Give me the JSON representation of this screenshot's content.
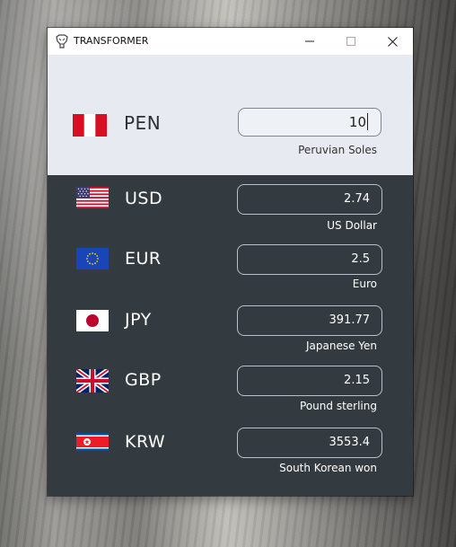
{
  "window": {
    "title": "TRANSFORMER"
  },
  "base": {
    "code": "PEN",
    "name": "Peruvian Soles",
    "amount": "10",
    "flag_icon": "peru-flag-icon"
  },
  "targets": [
    {
      "code": "USD",
      "name": "US Dollar",
      "value": "2.74",
      "flag_icon": "usa-flag-icon"
    },
    {
      "code": "EUR",
      "name": "Euro",
      "value": "2.5",
      "flag_icon": "eu-flag-icon"
    },
    {
      "code": "JPY",
      "name": "Japanese Yen",
      "value": "391.77",
      "flag_icon": "japan-flag-icon"
    },
    {
      "code": "GBP",
      "name": "Pound sterling",
      "value": "2.15",
      "flag_icon": "uk-flag-icon"
    },
    {
      "code": "KRW",
      "name": "South Korean won",
      "value": "3553.4",
      "flag_icon": "korea-flag-icon"
    }
  ],
  "colors": {
    "header_bg": "#e7ebf1",
    "body_bg": "#343b40",
    "peru_red": "#d91023"
  }
}
